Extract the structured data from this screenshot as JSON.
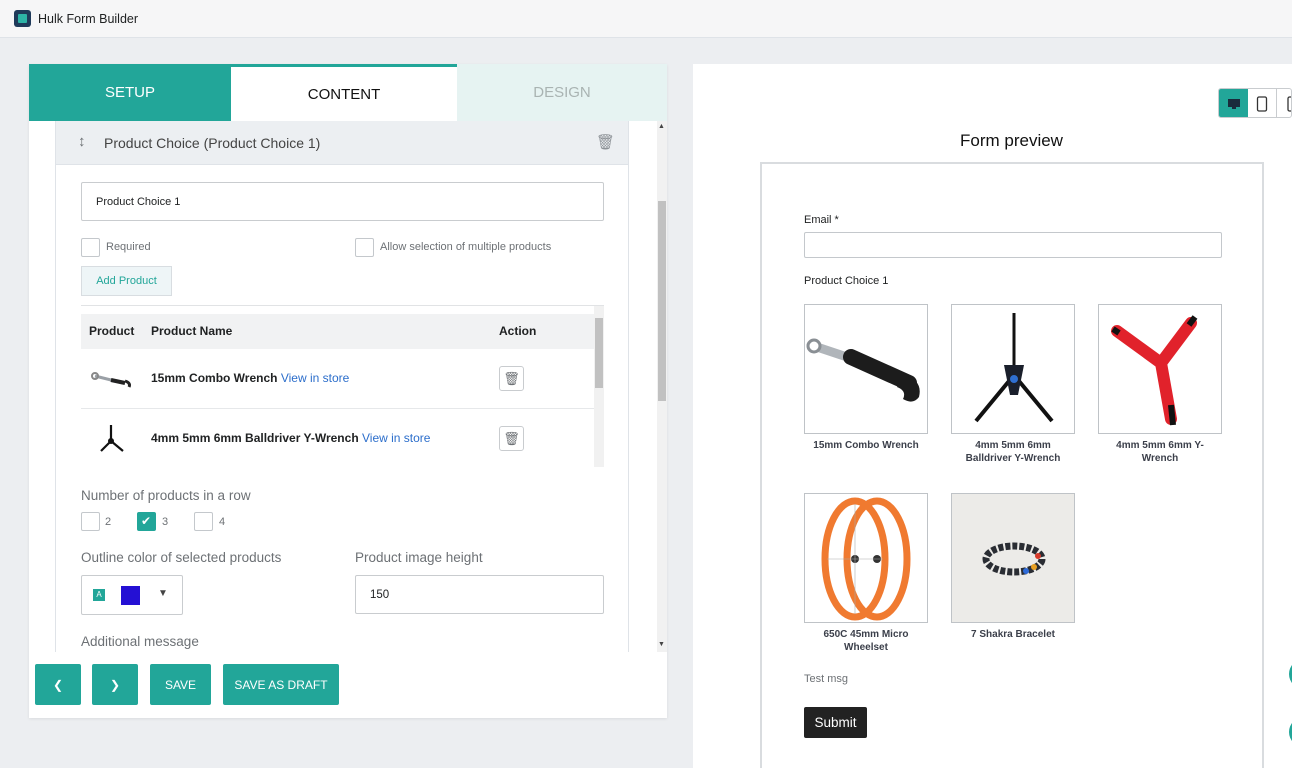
{
  "app": {
    "title": "Hulk Form Builder"
  },
  "tabs": {
    "setup": "SETUP",
    "content": "CONTENT",
    "design": "DESIGN",
    "active": "CONTENT"
  },
  "block": {
    "title": "Product Choice (Product Choice 1)",
    "name_value": "Product Choice 1",
    "required_label": "Required",
    "required_checked": false,
    "multiple_label": "Allow selection of multiple products",
    "multiple_checked": false,
    "add_product_label": "Add Product"
  },
  "product_table": {
    "headers": {
      "product": "Product",
      "name": "Product Name",
      "action": "Action"
    },
    "view_link": "View in store",
    "rows": [
      {
        "name": "15mm Combo Wrench",
        "thumb_icon": "wrench-thumb"
      },
      {
        "name": "4mm 5mm 6mm Balldriver Y-Wrench",
        "thumb_icon": "y-wrench-thumb"
      }
    ]
  },
  "row_count": {
    "label": "Number of products in a row",
    "options": [
      "2",
      "3",
      "4"
    ],
    "selected": "3"
  },
  "outline_color": {
    "label": "Outline color of selected products",
    "swatch": "#2410d4",
    "badge": "A"
  },
  "image_height": {
    "label": "Product image height",
    "value": "150"
  },
  "additional_message": {
    "label": "Additional message"
  },
  "bottom_buttons": {
    "save": "SAVE",
    "save_draft": "SAVE AS DRAFT"
  },
  "preview": {
    "title": "Form preview",
    "email_label": "Email *",
    "product_choice_label": "Product Choice 1",
    "products": [
      {
        "name": "15mm Combo Wrench",
        "line2": "",
        "image": "combo-wrench"
      },
      {
        "name": "4mm 5mm 6mm",
        "line2": "Balldriver Y-Wrench",
        "image": "balldriver-y-wrench"
      },
      {
        "name": "4mm 5mm 6mm Y-",
        "line2": "Wrench",
        "image": "red-y-wrench"
      },
      {
        "name": "650C 45mm Micro",
        "line2": "Wheelset",
        "image": "orange-wheelset"
      },
      {
        "name": "7 Shakra Bracelet",
        "line2": "",
        "image": "bead-bracelet"
      }
    ],
    "message": "Test msg",
    "submit": "Submit"
  },
  "colors": {
    "accent": "#22a699",
    "tab_inactive_bg": "#e6f3f2",
    "link": "#2c6ecb"
  }
}
